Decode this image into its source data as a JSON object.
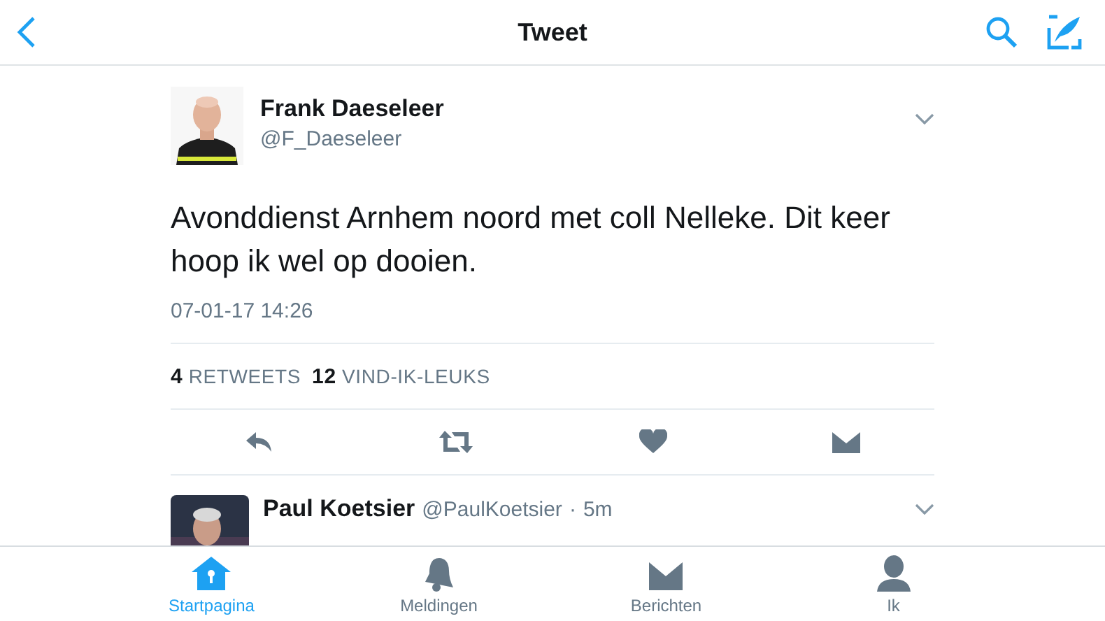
{
  "nav_bar": {
    "title": "Tweet"
  },
  "tweet": {
    "name": "Frank Daeseleer",
    "handle": "@F_Daeseleer",
    "text": "Avonddienst Arnhem noord met coll Nelleke. Dit keer hoop ik wel op dooien.",
    "timestamp": "07-01-17 14:26",
    "stats": [
      {
        "count": "4",
        "label": "RETWEETS"
      },
      {
        "count": "12",
        "label": "VIND-IK-LEUKS"
      }
    ],
    "actions": [
      {
        "kind": "reply"
      },
      {
        "kind": "retweet"
      },
      {
        "kind": "like"
      },
      {
        "kind": "message"
      }
    ]
  },
  "reply": {
    "name": "Paul Koetsier",
    "handle": "@PaulKoetsier",
    "separator": "·",
    "time": "5m"
  },
  "tab_bar": [
    {
      "label": "Startpagina",
      "kind": "home",
      "selected": true
    },
    {
      "label": "Meldingen",
      "kind": "notifications",
      "selected": false
    },
    {
      "label": "Berichten",
      "kind": "messages",
      "selected": false
    },
    {
      "label": "Ik",
      "kind": "me",
      "selected": false
    }
  ]
}
